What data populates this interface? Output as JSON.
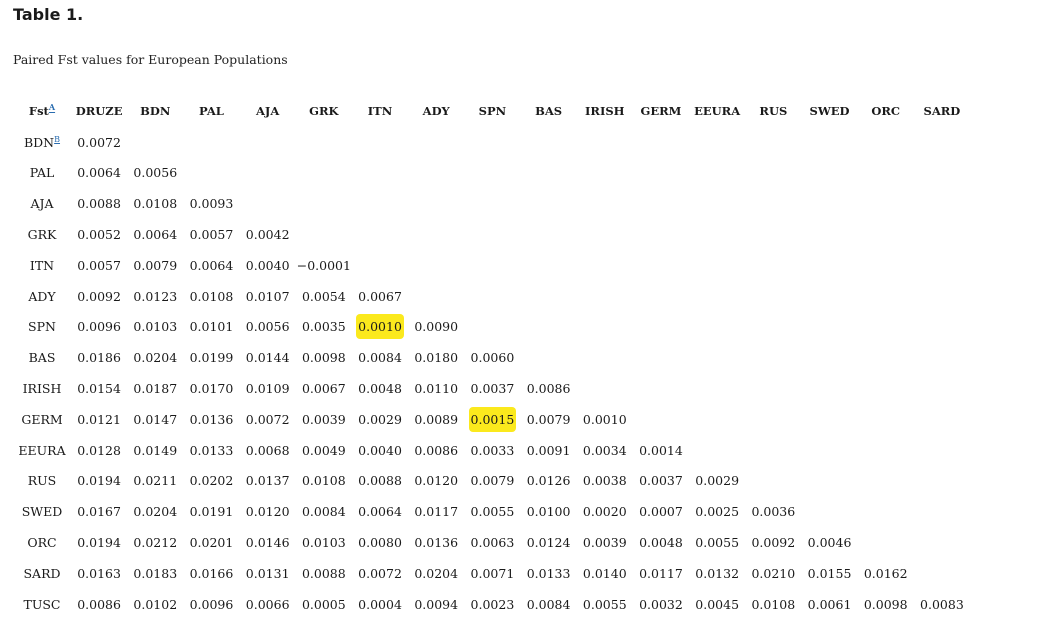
{
  "title": "Table 1.",
  "caption": "Paired Fst values for European Populations",
  "highlight_color": "#fbe91d",
  "corner": {
    "label": "Fst",
    "footnote": "A"
  },
  "columns": [
    "DRUZE",
    "BDN",
    "PAL",
    "AJA",
    "GRK",
    "ITN",
    "ADY",
    "SPN",
    "BAS",
    "IRISH",
    "GERM",
    "EEURA",
    "RUS",
    "SWED",
    "ORC",
    "SARD"
  ],
  "rows": [
    {
      "label": "BDN",
      "footnote": "B",
      "values": [
        "0.0072"
      ]
    },
    {
      "label": "PAL",
      "values": [
        "0.0064",
        "0.0056"
      ]
    },
    {
      "label": "AJA",
      "values": [
        "0.0088",
        "0.0108",
        "0.0093"
      ]
    },
    {
      "label": "GRK",
      "values": [
        "0.0052",
        "0.0064",
        "0.0057",
        "0.0042"
      ]
    },
    {
      "label": "ITN",
      "values": [
        "0.0057",
        "0.0079",
        "0.0064",
        "0.0040",
        "−0.0001"
      ]
    },
    {
      "label": "ADY",
      "values": [
        "0.0092",
        "0.0123",
        "0.0108",
        "0.0107",
        "0.0054",
        "0.0067"
      ]
    },
    {
      "label": "SPN",
      "values": [
        "0.0096",
        "0.0103",
        "0.0101",
        "0.0056",
        "0.0035",
        "0.0010",
        "0.0090"
      ],
      "highlight": [
        5
      ]
    },
    {
      "label": "BAS",
      "values": [
        "0.0186",
        "0.0204",
        "0.0199",
        "0.0144",
        "0.0098",
        "0.0084",
        "0.0180",
        "0.0060"
      ]
    },
    {
      "label": "IRISH",
      "values": [
        "0.0154",
        "0.0187",
        "0.0170",
        "0.0109",
        "0.0067",
        "0.0048",
        "0.0110",
        "0.0037",
        "0.0086"
      ]
    },
    {
      "label": "GERM",
      "values": [
        "0.0121",
        "0.0147",
        "0.0136",
        "0.0072",
        "0.0039",
        "0.0029",
        "0.0089",
        "0.0015",
        "0.0079",
        "0.0010"
      ],
      "highlight": [
        7
      ]
    },
    {
      "label": "EEURA",
      "values": [
        "0.0128",
        "0.0149",
        "0.0133",
        "0.0068",
        "0.0049",
        "0.0040",
        "0.0086",
        "0.0033",
        "0.0091",
        "0.0034",
        "0.0014"
      ]
    },
    {
      "label": "RUS",
      "values": [
        "0.0194",
        "0.0211",
        "0.0202",
        "0.0137",
        "0.0108",
        "0.0088",
        "0.0120",
        "0.0079",
        "0.0126",
        "0.0038",
        "0.0037",
        "0.0029"
      ]
    },
    {
      "label": "SWED",
      "values": [
        "0.0167",
        "0.0204",
        "0.0191",
        "0.0120",
        "0.0084",
        "0.0064",
        "0.0117",
        "0.0055",
        "0.0100",
        "0.0020",
        "0.0007",
        "0.0025",
        "0.0036"
      ]
    },
    {
      "label": "ORC",
      "values": [
        "0.0194",
        "0.0212",
        "0.0201",
        "0.0146",
        "0.0103",
        "0.0080",
        "0.0136",
        "0.0063",
        "0.0124",
        "0.0039",
        "0.0048",
        "0.0055",
        "0.0092",
        "0.0046"
      ]
    },
    {
      "label": "SARD",
      "values": [
        "0.0163",
        "0.0183",
        "0.0166",
        "0.0131",
        "0.0088",
        "0.0072",
        "0.0204",
        "0.0071",
        "0.0133",
        "0.0140",
        "0.0117",
        "0.0132",
        "0.0210",
        "0.0155",
        "0.0162"
      ]
    },
    {
      "label": "TUSC",
      "values": [
        "0.0086",
        "0.0102",
        "0.0096",
        "0.0066",
        "0.0005",
        "0.0004",
        "0.0094",
        "0.0023",
        "0.0084",
        "0.0055",
        "0.0032",
        "0.0045",
        "0.0108",
        "0.0061",
        "0.0098",
        "0.0083"
      ]
    }
  ]
}
